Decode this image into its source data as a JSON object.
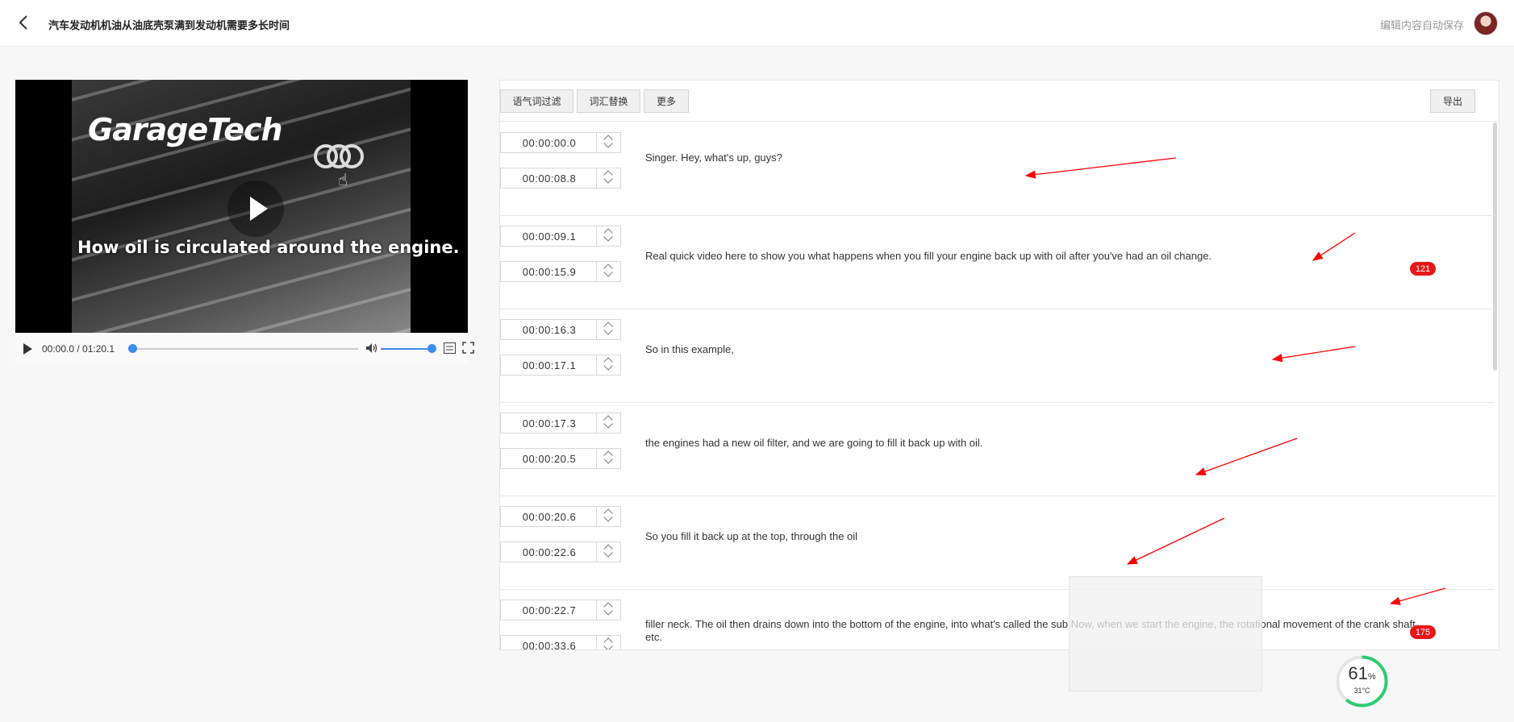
{
  "header": {
    "title": "汽车发动机机油从油底壳泵满到发动机需要多长时间",
    "autosave_text": "编辑内容自动保存"
  },
  "video": {
    "brand_text": "GarageTech",
    "caption_text": "How oil is circulated around the engine.",
    "time_display": "00:00.0 / 01:20.1",
    "progress": 0.0,
    "volume": 1.0
  },
  "toolbar": {
    "filter_label": "语气词过滤",
    "replace_label": "词汇替换",
    "more_label": "更多",
    "export_label": "导出"
  },
  "segments": [
    {
      "start": "00:00:00.0",
      "end": "00:00:08.8",
      "text": "Singer. Hey, what's up, guys?",
      "badge": ""
    },
    {
      "start": "00:00:09.1",
      "end": "00:00:15.9",
      "text": "Real quick video here to show you what happens when you fill your engine back up with oil after you've had an oil change.",
      "badge": "121"
    },
    {
      "start": "00:00:16.3",
      "end": "00:00:17.1",
      "text": "So in this example,",
      "badge": ""
    },
    {
      "start": "00:00:17.3",
      "end": "00:00:20.5",
      "text": "the engines had a new oil filter, and we are going to fill it back up with oil.",
      "badge": ""
    },
    {
      "start": "00:00:20.6",
      "end": "00:00:22.6",
      "text": "So you fill it back up at the top, through the oil",
      "badge": ""
    },
    {
      "start": "00:00:22.7",
      "end": "00:00:33.6",
      "text": "filler neck. The oil then drains down into the bottom of the engine, into what's called the sub Now, when we start the engine, the rotational movement of the crank shaft, etc.",
      "badge": "175"
    }
  ],
  "system_widget": {
    "percent": "61",
    "percent_unit": "%",
    "temperature": "31°C",
    "level": 0.61
  },
  "colors": {
    "accent": "#3d8bf2",
    "badge": "#e81818",
    "annotation_arrow": "#ff0000",
    "gauge": "#2ecc71"
  }
}
